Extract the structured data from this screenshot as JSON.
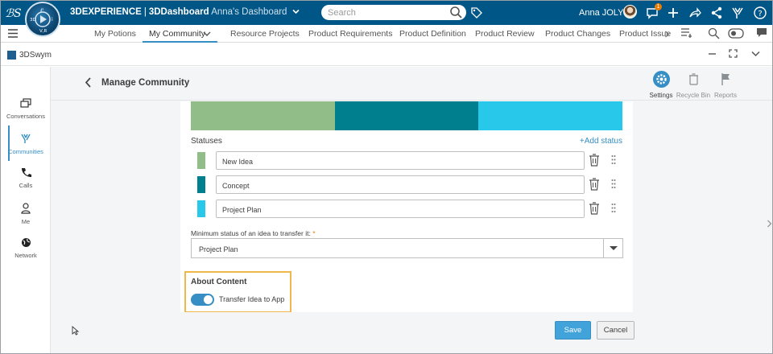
{
  "topbar": {
    "brand_main": "3DEXPERIENCE",
    "brand_sep": "|",
    "brand_dash": "3DDashboard",
    "brand_dashboard": "Anna's Dashboard",
    "compass_label": "V,R",
    "compass_num": "3D",
    "search_placeholder": "Search",
    "user_name": "Anna JOLY",
    "notification_count": "1",
    "icons": [
      "compass-icon",
      "search-icon",
      "tag-icon",
      "avatar",
      "notifications-icon",
      "add-icon",
      "share-icon",
      "network-icon",
      "tools-icon",
      "help-icon"
    ],
    "bar_color": "#005686"
  },
  "nav": {
    "tabs": [
      {
        "label": "My Potions",
        "active": false
      },
      {
        "label": "My Community",
        "active": true
      },
      {
        "label": "Resource Projects",
        "active": false
      },
      {
        "label": "Product Requirements",
        "active": false
      },
      {
        "label": "Product Definition",
        "active": false
      },
      {
        "label": "Product Review",
        "active": false
      },
      {
        "label": "Product Changes",
        "active": false
      },
      {
        "label": "Product Issue",
        "active": false
      }
    ]
  },
  "app": {
    "name": "3DSwym"
  },
  "sidebar": {
    "items": [
      {
        "label": "Conversations",
        "icon": "conversations-icon"
      },
      {
        "label": "Communities",
        "icon": "communities-icon",
        "active": true
      },
      {
        "label": "Calls",
        "icon": "phone-icon"
      },
      {
        "label": "Me",
        "icon": "person-icon"
      },
      {
        "label": "Network",
        "icon": "globe-icon"
      }
    ]
  },
  "header": {
    "title": "Manage Community",
    "actions": [
      {
        "label": "Settings",
        "icon": "gear-icon",
        "active": true
      },
      {
        "label": "Recycle Bin",
        "icon": "recycle-bin-icon"
      },
      {
        "label": "Reports",
        "icon": "flag-icon"
      }
    ]
  },
  "form": {
    "color_bar": [
      "#91bd88",
      "#00808f",
      "#27c8e9"
    ],
    "statuses_label": "Statuses",
    "add_status_label": "Add status",
    "add_status_icon": "+",
    "statuses": [
      {
        "name": "New Idea",
        "color": "#91bd88"
      },
      {
        "name": "Concept",
        "color": "#00808f"
      },
      {
        "name": "Project Plan",
        "color": "#27c8e9"
      }
    ],
    "min_status_label": "Minimum status of an idea to transfer it:",
    "required_mark": "*",
    "min_status_value": "Project Plan",
    "about_title": "About Content",
    "transfer_toggle_label": "Transfer Idea to App",
    "transfer_toggle_on": true,
    "highlight_color": "#f0b84a"
  },
  "footer": {
    "save_label": "Save",
    "cancel_label": "Cancel",
    "accent": "#42a2da"
  }
}
